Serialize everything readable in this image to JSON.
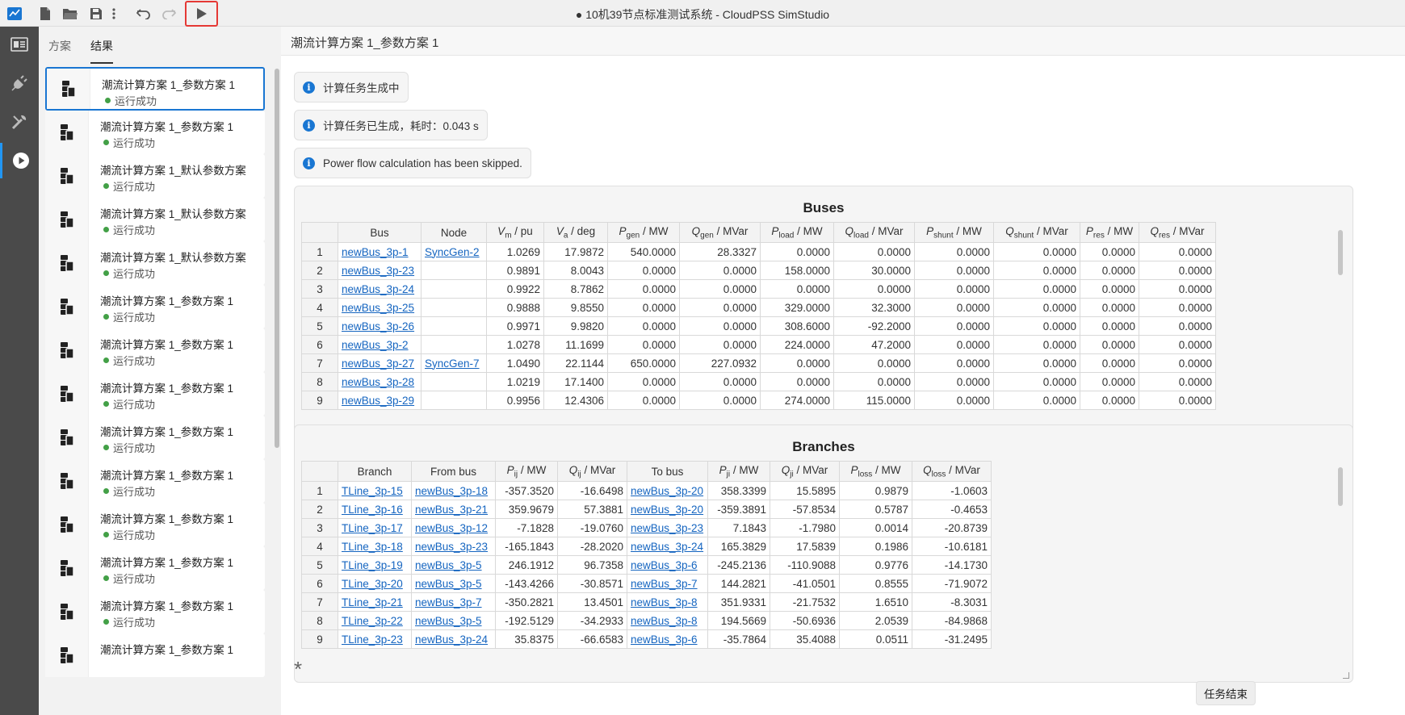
{
  "window": {
    "title": "● 10机39节点标准测试系统 - CloudPSS SimStudio"
  },
  "toolbar": {
    "icons": [
      "app-logo-icon",
      "new-file-icon",
      "open-folder-icon",
      "save-icon",
      "more-vert-icon",
      "undo-icon",
      "redo-icon",
      "run-icon"
    ]
  },
  "activity": [
    "dashboard-icon",
    "plugin-icon",
    "tools-icon",
    "play-circle-icon"
  ],
  "sidebar": {
    "tabs": [
      "方案",
      "结果"
    ],
    "items": [
      {
        "name": "潮流计算方案 1_参数方案 1",
        "status": "运行成功"
      },
      {
        "name": "潮流计算方案 1_参数方案 1",
        "status": "运行成功"
      },
      {
        "name": "潮流计算方案 1_默认参数方案",
        "status": "运行成功"
      },
      {
        "name": "潮流计算方案 1_默认参数方案",
        "status": "运行成功"
      },
      {
        "name": "潮流计算方案 1_默认参数方案",
        "status": "运行成功"
      },
      {
        "name": "潮流计算方案 1_参数方案 1",
        "status": "运行成功"
      },
      {
        "name": "潮流计算方案 1_参数方案 1",
        "status": "运行成功"
      },
      {
        "name": "潮流计算方案 1_参数方案 1",
        "status": "运行成功"
      },
      {
        "name": "潮流计算方案 1_参数方案 1",
        "status": "运行成功"
      },
      {
        "name": "潮流计算方案 1_参数方案 1",
        "status": "运行成功"
      },
      {
        "name": "潮流计算方案 1_参数方案 1",
        "status": "运行成功"
      },
      {
        "name": "潮流计算方案 1_参数方案 1",
        "status": "运行成功"
      },
      {
        "name": "潮流计算方案 1_参数方案 1",
        "status": "运行成功"
      },
      {
        "name": "潮流计算方案 1_参数方案 1",
        "status": ""
      }
    ]
  },
  "main": {
    "title": "潮流计算方案 1_参数方案 1",
    "messages": [
      "计算任务生成中",
      "计算任务已生成，耗时：0.043 s",
      "Power flow calculation has been skipped."
    ],
    "info_glyph": "i",
    "buses": {
      "title": "Buses",
      "headers": [
        {
          "main": "Bus"
        },
        {
          "main": "Node"
        },
        {
          "sym": "V",
          "sub": "m",
          "unit": " / pu"
        },
        {
          "sym": "V",
          "sub": "a",
          "unit": " / deg"
        },
        {
          "sym": "P",
          "sub": "gen",
          "unit": " / MW"
        },
        {
          "sym": "Q",
          "sub": "gen",
          "unit": " / MVar"
        },
        {
          "sym": "P",
          "sub": "load",
          "unit": " / MW"
        },
        {
          "sym": "Q",
          "sub": "load",
          "unit": " / MVar"
        },
        {
          "sym": "P",
          "sub": "shunt",
          "unit": " / MW"
        },
        {
          "sym": "Q",
          "sub": "shunt",
          "unit": " / MVar"
        },
        {
          "sym": "P",
          "sub": "res",
          "unit": " / MW"
        },
        {
          "sym": "Q",
          "sub": "res",
          "unit": " / MVar"
        }
      ],
      "rows": [
        [
          "1",
          "newBus_3p-1",
          "SyncGen-2",
          "1.0269",
          "17.9872",
          "540.0000",
          "28.3327",
          "0.0000",
          "0.0000",
          "0.0000",
          "0.0000",
          "0.0000",
          "0.0000"
        ],
        [
          "2",
          "newBus_3p-23",
          "",
          "0.9891",
          "8.0043",
          "0.0000",
          "0.0000",
          "158.0000",
          "30.0000",
          "0.0000",
          "0.0000",
          "0.0000",
          "0.0000"
        ],
        [
          "3",
          "newBus_3p-24",
          "",
          "0.9922",
          "8.7862",
          "0.0000",
          "0.0000",
          "0.0000",
          "0.0000",
          "0.0000",
          "0.0000",
          "0.0000",
          "0.0000"
        ],
        [
          "4",
          "newBus_3p-25",
          "",
          "0.9888",
          "9.8550",
          "0.0000",
          "0.0000",
          "329.0000",
          "32.3000",
          "0.0000",
          "0.0000",
          "0.0000",
          "0.0000"
        ],
        [
          "5",
          "newBus_3p-26",
          "",
          "0.9971",
          "9.9820",
          "0.0000",
          "0.0000",
          "308.6000",
          "-92.2000",
          "0.0000",
          "0.0000",
          "0.0000",
          "0.0000"
        ],
        [
          "6",
          "newBus_3p-2",
          "",
          "1.0278",
          "11.1699",
          "0.0000",
          "0.0000",
          "224.0000",
          "47.2000",
          "0.0000",
          "0.0000",
          "0.0000",
          "0.0000"
        ],
        [
          "7",
          "newBus_3p-27",
          "SyncGen-7",
          "1.0490",
          "22.1144",
          "650.0000",
          "227.0932",
          "0.0000",
          "0.0000",
          "0.0000",
          "0.0000",
          "0.0000",
          "0.0000"
        ],
        [
          "8",
          "newBus_3p-28",
          "",
          "1.0219",
          "17.1400",
          "0.0000",
          "0.0000",
          "0.0000",
          "0.0000",
          "0.0000",
          "0.0000",
          "0.0000",
          "0.0000"
        ],
        [
          "9",
          "newBus_3p-29",
          "",
          "0.9956",
          "12.4306",
          "0.0000",
          "0.0000",
          "274.0000",
          "115.0000",
          "0.0000",
          "0.0000",
          "0.0000",
          "0.0000"
        ]
      ]
    },
    "branches": {
      "title": "Branches",
      "headers": [
        {
          "main": "Branch"
        },
        {
          "main": "From bus"
        },
        {
          "sym": "P",
          "sub": "ij",
          "unit": " / MW"
        },
        {
          "sym": "Q",
          "sub": "ij",
          "unit": " / MVar"
        },
        {
          "main": "To bus"
        },
        {
          "sym": "P",
          "sub": "ji",
          "unit": " / MW"
        },
        {
          "sym": "Q",
          "sub": "ji",
          "unit": " / MVar"
        },
        {
          "sym": "P",
          "sub": "loss",
          "unit": " / MW"
        },
        {
          "sym": "Q",
          "sub": "loss",
          "unit": " / MVar"
        }
      ],
      "rows": [
        [
          "1",
          "TLine_3p-15",
          "newBus_3p-18",
          "-357.3520",
          "-16.6498",
          "newBus_3p-20",
          "358.3399",
          "15.5895",
          "0.9879",
          "-1.0603"
        ],
        [
          "2",
          "TLine_3p-16",
          "newBus_3p-21",
          "359.9679",
          "57.3881",
          "newBus_3p-20",
          "-359.3891",
          "-57.8534",
          "0.5787",
          "-0.4653"
        ],
        [
          "3",
          "TLine_3p-17",
          "newBus_3p-12",
          "-7.1828",
          "-19.0760",
          "newBus_3p-23",
          "7.1843",
          "-1.7980",
          "0.0014",
          "-20.8739"
        ],
        [
          "4",
          "TLine_3p-18",
          "newBus_3p-23",
          "-165.1843",
          "-28.2020",
          "newBus_3p-24",
          "165.3829",
          "17.5839",
          "0.1986",
          "-10.6181"
        ],
        [
          "5",
          "TLine_3p-19",
          "newBus_3p-5",
          "246.1912",
          "96.7358",
          "newBus_3p-6",
          "-245.2136",
          "-110.9088",
          "0.9776",
          "-14.1730"
        ],
        [
          "6",
          "TLine_3p-20",
          "newBus_3p-5",
          "-143.4266",
          "-30.8571",
          "newBus_3p-7",
          "144.2821",
          "-41.0501",
          "0.8555",
          "-71.9072"
        ],
        [
          "7",
          "TLine_3p-21",
          "newBus_3p-7",
          "-350.2821",
          "13.4501",
          "newBus_3p-8",
          "351.9331",
          "-21.7532",
          "1.6510",
          "-8.3031"
        ],
        [
          "8",
          "TLine_3p-22",
          "newBus_3p-5",
          "-192.5129",
          "-34.2933",
          "newBus_3p-8",
          "194.5669",
          "-50.6936",
          "2.0539",
          "-84.9868"
        ],
        [
          "9",
          "TLine_3p-23",
          "newBus_3p-24",
          "35.8375",
          "-66.6583",
          "newBus_3p-6",
          "-35.7864",
          "35.4088",
          "0.0511",
          "-31.2495"
        ]
      ]
    },
    "asterisk": "*",
    "done_button": "任务结束"
  }
}
